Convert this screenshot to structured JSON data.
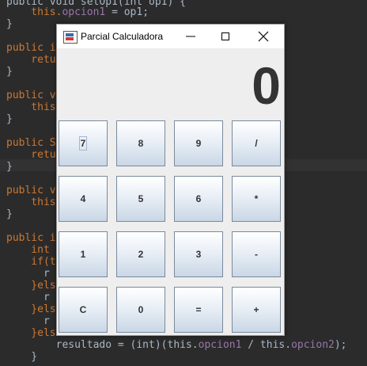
{
  "window": {
    "title": "Parcial Calculadora",
    "display_value": "0"
  },
  "keys": [
    {
      "label": "7"
    },
    {
      "label": "8"
    },
    {
      "label": "9"
    },
    {
      "label": "/"
    },
    {
      "label": "4"
    },
    {
      "label": "5"
    },
    {
      "label": "6"
    },
    {
      "label": "*"
    },
    {
      "label": "1"
    },
    {
      "label": "2"
    },
    {
      "label": "3"
    },
    {
      "label": "-"
    },
    {
      "label": "C"
    },
    {
      "label": "0"
    },
    {
      "label": "="
    },
    {
      "label": "+"
    }
  ],
  "code": {
    "l1a": "public void setOp1(int op1) {",
    "l2a": "    this.",
    "l2b": "opcion1",
    "l2c": " = op1;",
    "l3": "}",
    "l4": "public in",
    "l5": "    retur",
    "l6": "}",
    "l7": "public vo",
    "l8": "    this.",
    "l9": "}",
    "l10": "public St",
    "l11": "    retur",
    "l12": "}",
    "l13": "public vo",
    "l14": "    this.",
    "l15": "}",
    "l16": "public in",
    "l17": "    int r",
    "l18": "    if(th",
    "l19": "      r",
    "l20": "    }else",
    "l21": "      r",
    "l22": "    }else",
    "l23": "      r",
    "l24": "    }else",
    "l25a": "        resultado = (int)(this.",
    "l25b": "opcion1",
    "l25c": " / this.",
    "l25d": "opcion2",
    "l25e": ");",
    "l26": "    }"
  },
  "colors": {
    "editor_bg": "#2b2b2b",
    "keyword": "#cc7832",
    "field": "#9876aa",
    "text": "#a9b7c6"
  }
}
